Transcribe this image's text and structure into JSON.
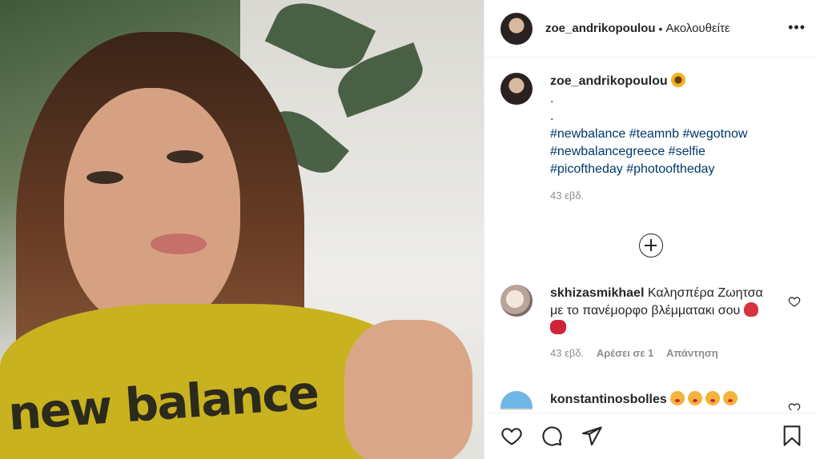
{
  "post": {
    "username": "zoe_andrikopoulou",
    "separator": "•",
    "follow_status": "Ακολουθείτε",
    "more_options": "•••"
  },
  "photo": {
    "brand_text": "new balance"
  },
  "caption": {
    "username": "zoe_andrikopoulou",
    "emoji": "sunflower",
    "dot1": ".",
    "dot2": ".",
    "hashtags": [
      "#newbalance",
      "#teamnb",
      "#wegotnow",
      "#newbalancegreece",
      "#selfie",
      "#picoftheday",
      "#photooftheday"
    ],
    "time": "43 εβδ."
  },
  "comments": [
    {
      "username": "skhizasmikhael",
      "text": "Καλησπέρα Ζωητσα με το πανέμορφο βλέμματακι σου",
      "emojis": [
        "rose",
        "kiss-mark"
      ],
      "time": "43 εβδ.",
      "likes": "Αρέσει σε 1",
      "reply": "Απάντηση"
    },
    {
      "username": "konstantinosbolles",
      "emojis": [
        "face-blowing-kiss",
        "face-blowing-kiss",
        "face-blowing-kiss",
        "face-blowing-kiss"
      ]
    }
  ],
  "icons": {
    "like": "heart-icon",
    "comment": "comment-icon",
    "share": "send-icon",
    "save": "bookmark-icon",
    "load_more": "plus-circle-icon"
  },
  "colors": {
    "text": "#262626",
    "secondary": "#8e8e8e",
    "hashtag": "#00376b",
    "divider": "#efefef"
  }
}
